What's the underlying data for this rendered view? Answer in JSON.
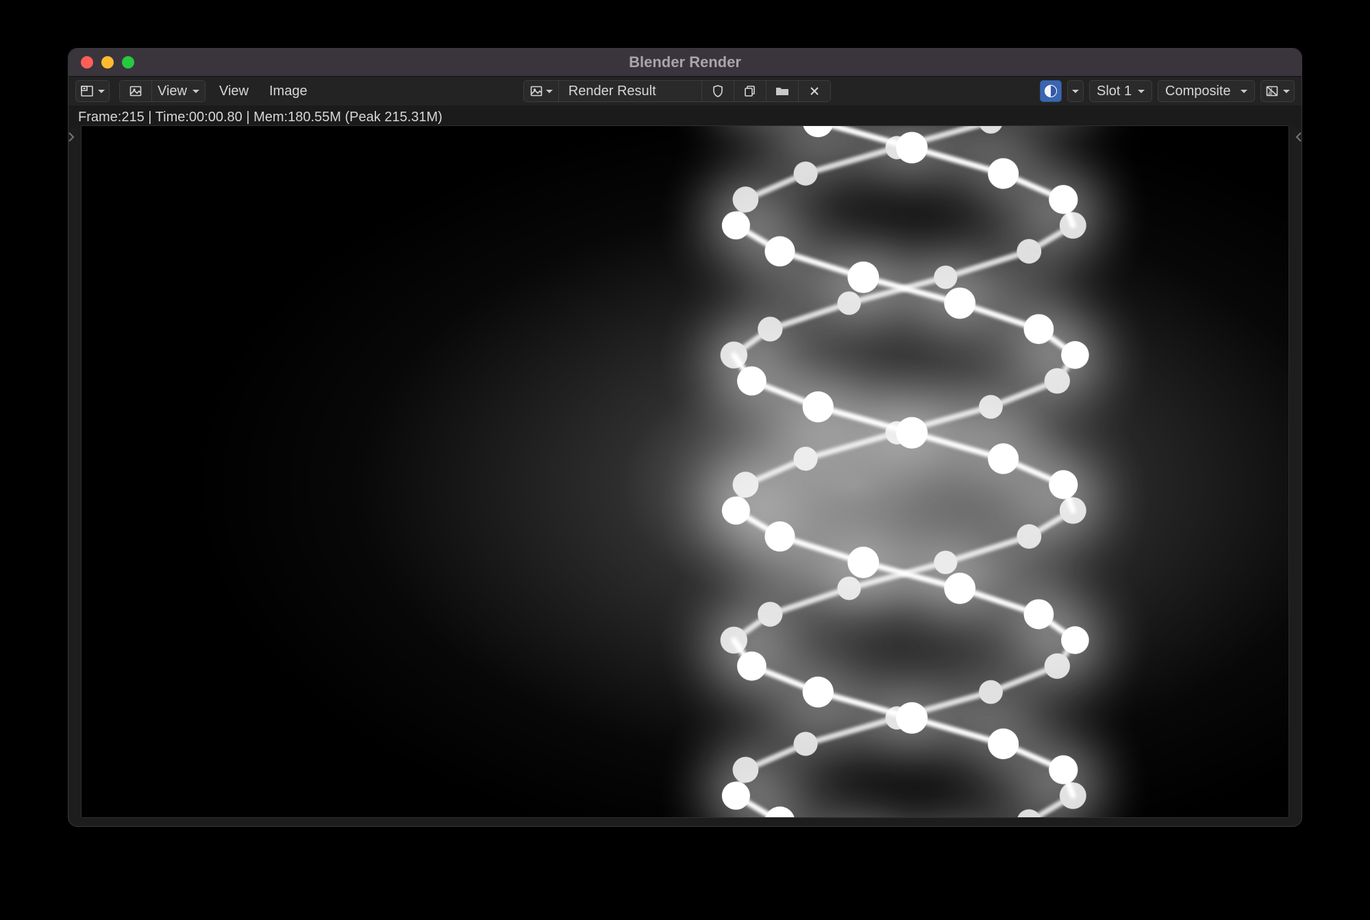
{
  "window": {
    "title": "Blender Render"
  },
  "header": {
    "view_label": "View",
    "view_menu": "View",
    "image_menu": "Image",
    "image_name": "Render Result",
    "slot": "Slot 1",
    "pass": "Composite"
  },
  "status": {
    "text": "Frame:215 | Time:00:00.80 | Mem:180.55M (Peak 215.31M)"
  },
  "icons": {
    "editor_type": "image-editor-icon",
    "mode": "view-mode-icon",
    "browse_img": "image-browse-icon",
    "fake_user": "shield-icon",
    "duplicate": "duplicate-icon",
    "open": "folder-icon",
    "unlink": "close-icon",
    "color_mgmt": "color-management-icon",
    "channels": "channels-icon",
    "zoom": "magnifier-icon",
    "pan": "hand-icon"
  },
  "colors": {
    "chrome": "#232323",
    "titlebar": "#3a353c",
    "accent": "#3a66b1",
    "text": "#d6d6d6"
  }
}
